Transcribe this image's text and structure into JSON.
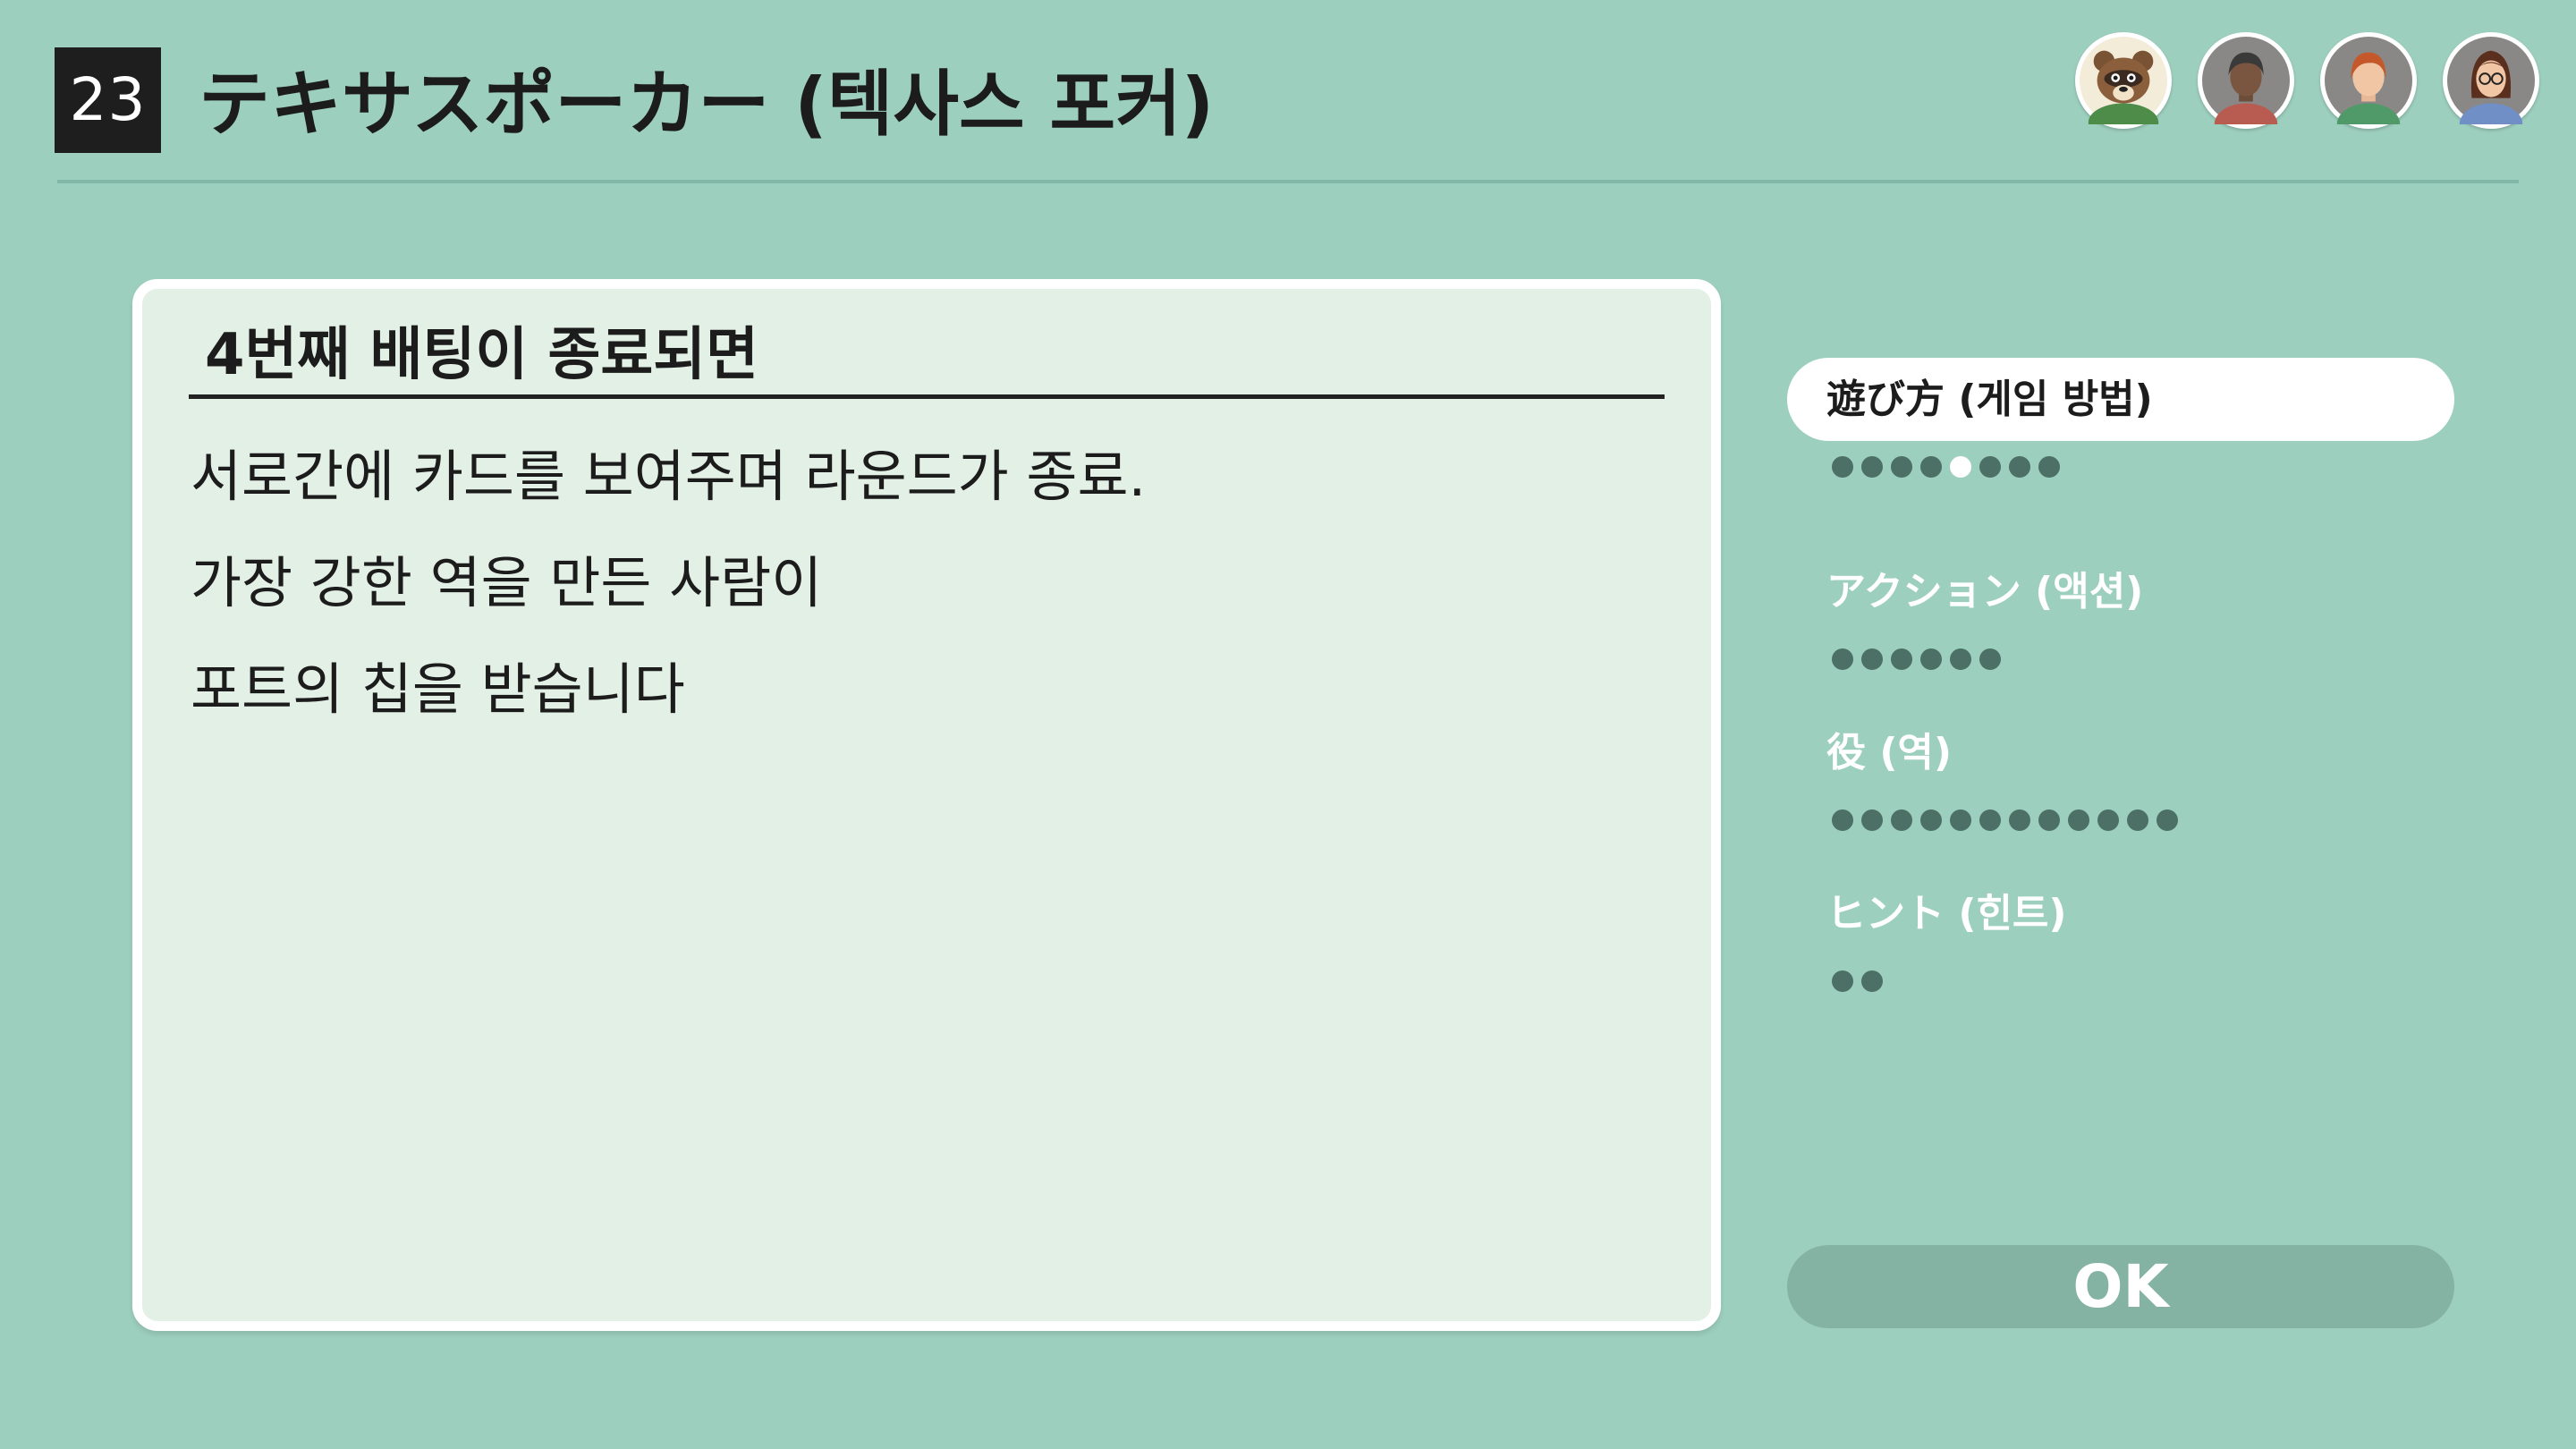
{
  "header": {
    "game_number": "23",
    "title": "テキサスポーカー (텍사스 포커)"
  },
  "players": [
    {
      "name": "tom-nook-avatar",
      "type": "raccoon"
    },
    {
      "name": "player-avatar-2",
      "type": "mii"
    },
    {
      "name": "player-avatar-3",
      "type": "mii"
    },
    {
      "name": "player-avatar-4",
      "type": "mii"
    }
  ],
  "card": {
    "title": "4번째 배팅이 종료되면",
    "lines": [
      "서로간에 카드를 보여주며 라운드가 종료.",
      "가장 강한 역을 만든 사람이",
      "포트의 칩을 받습니다"
    ]
  },
  "sections": [
    {
      "label": "遊び方 (게임 방법)",
      "active": true,
      "pages": 8,
      "current_page": 5
    },
    {
      "label": "アクション (액션)",
      "active": false,
      "pages": 6,
      "current_page": null
    },
    {
      "label": "役 (역)",
      "active": false,
      "pages": 12,
      "current_page": null
    },
    {
      "label": "ヒント (힌트)",
      "active": false,
      "pages": 2,
      "current_page": null
    }
  ],
  "ok_button": {
    "label": "OK"
  },
  "colors": {
    "background": "#9dcfbe",
    "card": "#e3f0e6",
    "dot": "#4c6f66",
    "ok_button": "#85b3a3"
  }
}
